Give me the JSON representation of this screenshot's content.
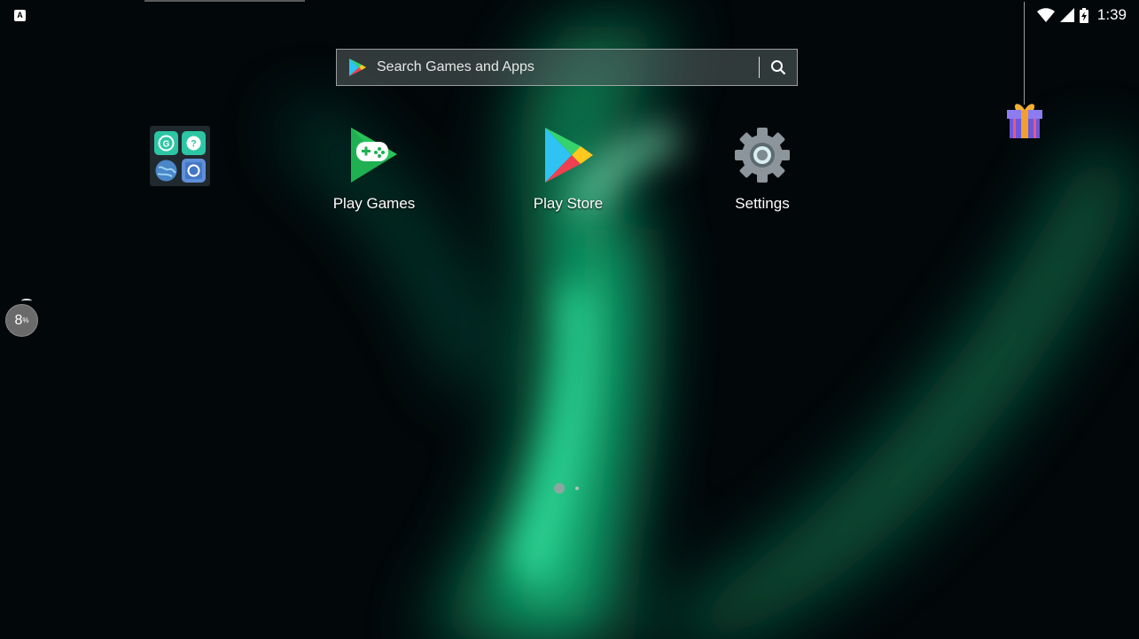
{
  "status_bar": {
    "time": "1:39",
    "notification_icon": "A",
    "icons": [
      "wifi-icon",
      "signal-icon",
      "battery-charging-icon"
    ]
  },
  "search": {
    "placeholder": "Search Games and Apps",
    "icon": "search-icon"
  },
  "folder": {
    "apps": [
      "grammar-app-icon",
      "help-app-icon",
      "globe-app-icon",
      "camera-app-icon"
    ]
  },
  "apps": [
    {
      "label": "Play Games",
      "icon": "play-games-icon"
    },
    {
      "label": "Play Store",
      "icon": "play-store-icon"
    },
    {
      "label": "Settings",
      "icon": "settings-gear-icon"
    }
  ],
  "badge": {
    "value": "8",
    "unit": "%"
  },
  "pages": {
    "count": 2,
    "current": 1
  },
  "colors": {
    "aurora": "#14e38c",
    "play_games_green": "#1fb052",
    "settings_gray": "#8b959b",
    "gift_purple": "#7c6ce4"
  }
}
